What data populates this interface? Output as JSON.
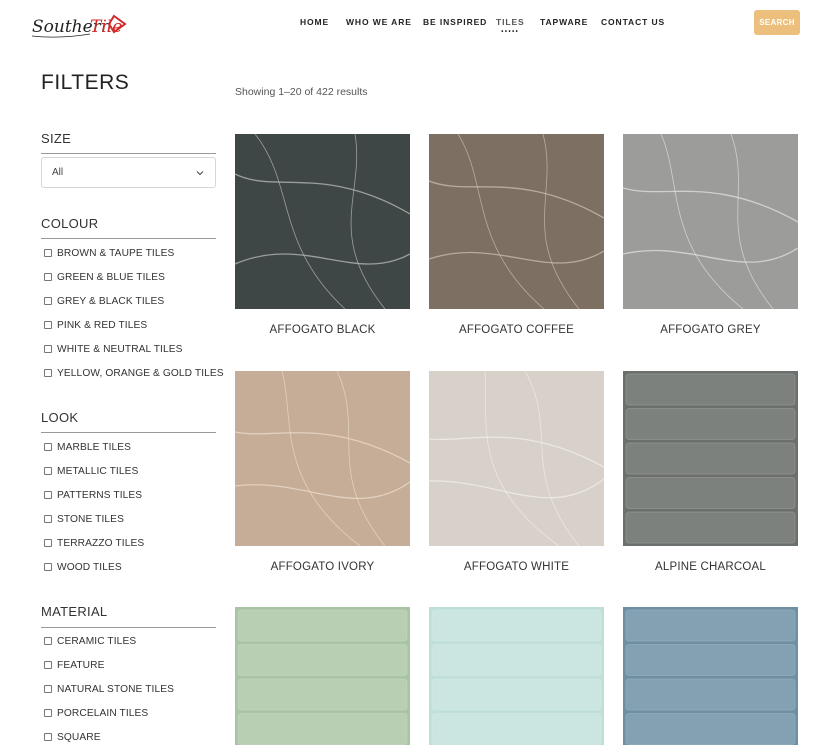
{
  "header": {
    "logo_text": "Southern Tile",
    "nav": [
      {
        "label": "HOME",
        "active": false
      },
      {
        "label": "WHO WE ARE",
        "active": false
      },
      {
        "label": "BE INSPIRED",
        "active": false
      },
      {
        "label": "TILES",
        "active": true
      },
      {
        "label": "TAPWARE",
        "active": false
      },
      {
        "label": "CONTACT US",
        "active": false
      }
    ],
    "search_label": "SEARCH",
    "search_color": "#ecbf7d"
  },
  "sidebar": {
    "title": "FILTERS",
    "size": {
      "title": "SIZE",
      "selected": "All"
    },
    "colour": {
      "title": "COLOUR",
      "options": [
        "BROWN & TAUPE TILES",
        "GREEN & BLUE TILES",
        "GREY & BLACK TILES",
        "PINK & RED TILES",
        "WHITE & NEUTRAL TILES",
        "YELLOW, ORANGE & GOLD TILES"
      ]
    },
    "look": {
      "title": "LOOK",
      "options": [
        "MARBLE TILES",
        "METALLIC TILES",
        "PATTERNS TILES",
        "STONE TILES",
        "TERRAZZO TILES",
        "WOOD TILES"
      ]
    },
    "material": {
      "title": "MATERIAL",
      "options": [
        "CERAMIC TILES",
        "FEATURE",
        "NATURAL STONE TILES",
        "PORCELAIN TILES",
        "SQUARE"
      ]
    }
  },
  "main": {
    "results_text": "Showing 1–20 of 422 results",
    "products": [
      {
        "name": "AFFOGATO BLACK",
        "swatch": "#3f4646",
        "vein": "#b9bdbb",
        "style": "marble"
      },
      {
        "name": "AFFOGATO COFFEE",
        "swatch": "#7e6f63",
        "vein": "#cdbfae",
        "style": "marble"
      },
      {
        "name": "AFFOGATO GREY",
        "swatch": "#9c9c9a",
        "vein": "#e2e2df",
        "style": "marble"
      },
      {
        "name": "AFFOGATO IVORY",
        "swatch": "#c5ad98",
        "vein": "#ebdecd",
        "style": "marble"
      },
      {
        "name": "AFFOGATO WHITE",
        "swatch": "#d8d1c9",
        "vein": "#f3eee8",
        "style": "marble"
      },
      {
        "name": "ALPINE CHARCOAL",
        "swatch": "#6c706c",
        "vein": "#9ea19d",
        "style": "subway"
      },
      {
        "name": "",
        "swatch": "#a9c4a4",
        "vein": "#d6e6d2",
        "style": "subway"
      },
      {
        "name": "",
        "swatch": "#bfe0d8",
        "vein": "#e3f3ef",
        "style": "subway"
      },
      {
        "name": "",
        "swatch": "#6f90a3",
        "vein": "#a9c1cf",
        "style": "subway"
      }
    ]
  }
}
